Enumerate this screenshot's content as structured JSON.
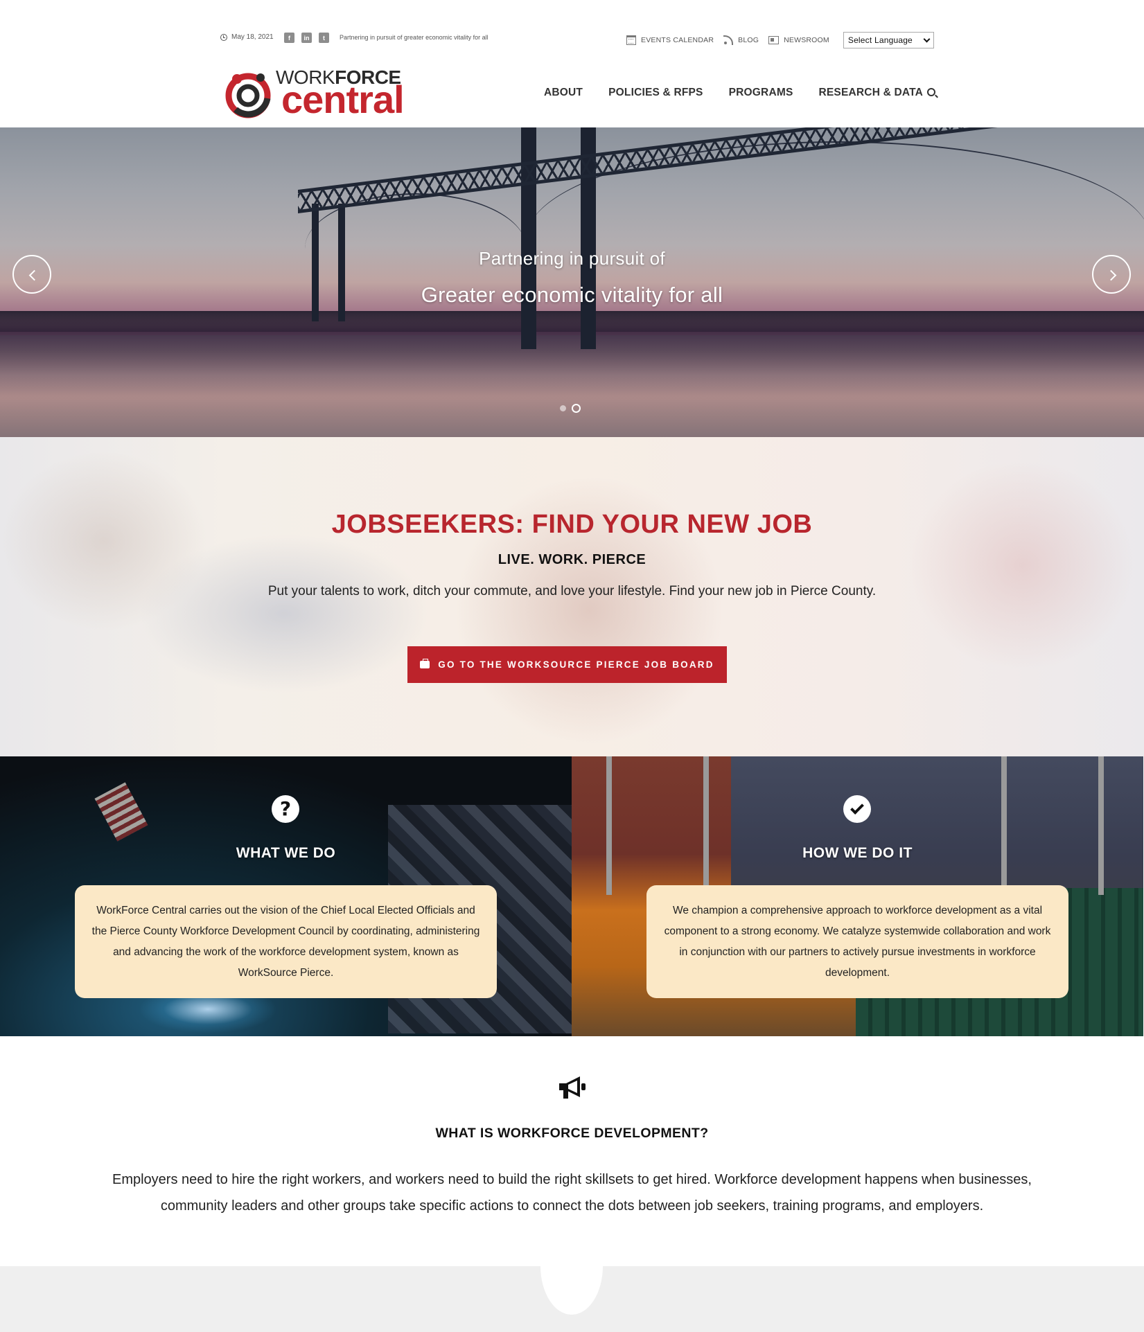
{
  "colors": {
    "accent": "#bc232b",
    "brand_red": "#c4262e",
    "card": "#fbe8c6",
    "text": "#222222"
  },
  "topbar": {
    "date": "May 18, 2021",
    "socials": [
      {
        "icon": "facebook-icon",
        "glyph": "f"
      },
      {
        "icon": "linkedin-icon",
        "glyph": "in"
      },
      {
        "icon": "twitter-icon",
        "glyph": "t"
      }
    ],
    "tagline": "Partnering in pursuit of greater economic vitality for all",
    "links": [
      {
        "label": "EVENTS CALENDAR",
        "icon": "calendar-icon"
      },
      {
        "label": "BLOG",
        "icon": "rss-icon"
      },
      {
        "label": "NEWSROOM",
        "icon": "newspaper-icon"
      }
    ],
    "language_select": "Select Language"
  },
  "logo": {
    "top_light": "WORK",
    "top_bold": "FORCE",
    "bottom": "central"
  },
  "nav": {
    "items": [
      {
        "label": "ABOUT"
      },
      {
        "label": "POLICIES & RFPS"
      },
      {
        "label": "PROGRAMS"
      },
      {
        "label": "RESEARCH & DATA"
      }
    ]
  },
  "hero": {
    "line1": "Partnering in pursuit of",
    "line2": "Greater economic vitality for all",
    "slide_count": 2,
    "active_slide": 2
  },
  "jobs": {
    "title": "JOBSEEKERS: FIND YOUR NEW JOB",
    "subtitle": "LIVE. WORK. PIERCE",
    "body": "Put your talents to work, ditch your commute, and love your lifestyle. Find your new job in Pierce County.",
    "button": "GO TO THE WORKSOURCE PIERCE JOB BOARD"
  },
  "panels": [
    {
      "icon": "question-icon",
      "title": "WHAT WE DO",
      "body": "WorkForce Central carries out the vision of the Chief Local Elected Officials and the Pierce County Workforce Development Council by coordinating, administering and advancing the work of the workforce development system, known as WorkSource Pierce."
    },
    {
      "icon": "check-icon",
      "title": "HOW WE DO IT",
      "body": "We champion a comprehensive approach to workforce development as a vital component to a strong economy. We catalyze systemwide collaboration and work in conjunction with our partners to actively pursue investments in workforce development."
    }
  ],
  "workforce_dev": {
    "icon": "megaphone-icon",
    "title": "WHAT IS WORKFORCE DEVELOPMENT?",
    "body": "Employers need to hire the right workers, and workers need to build the right skillsets to get hired. Workforce development happens when businesses, community leaders and other groups take specific actions to connect the dots between job seekers, training programs, and employers."
  }
}
